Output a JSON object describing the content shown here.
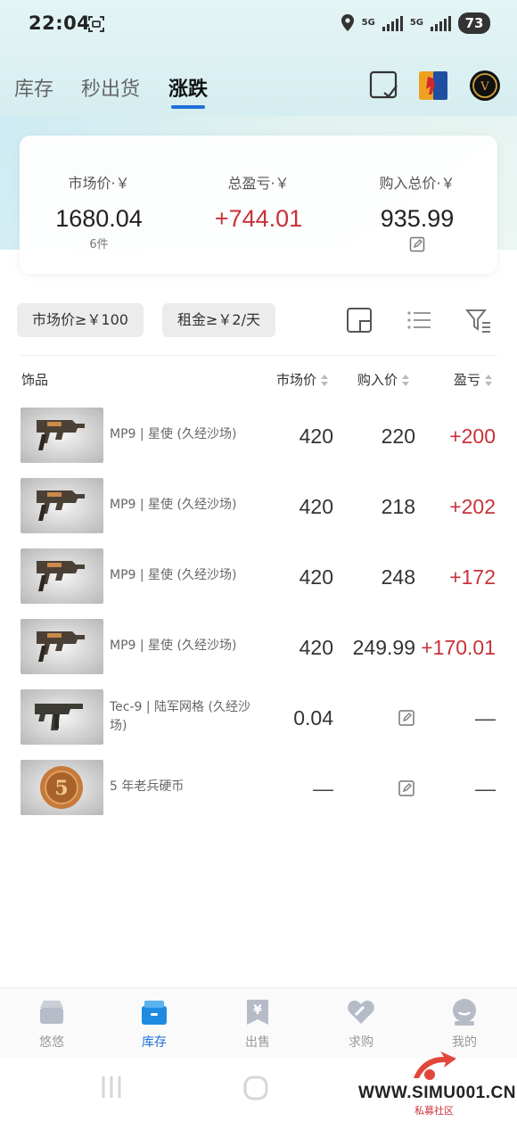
{
  "status": {
    "time": "22:04",
    "network": "5G",
    "battery": "73"
  },
  "tabs": [
    {
      "label": "库存",
      "active": false
    },
    {
      "label": "秒出货",
      "active": false
    },
    {
      "label": "涨跌",
      "active": true
    }
  ],
  "summary": {
    "market_label": "市场价·￥",
    "market_value": "1680.04",
    "market_count": "6件",
    "profit_label": "总盈亏·￥",
    "profit_value": "+744.01",
    "cost_label": "购入总价·￥",
    "cost_value": "935.99"
  },
  "filters": {
    "chip1": "市场价≥￥100",
    "chip2": "租金≥￥2/天"
  },
  "table": {
    "headers": {
      "item": "饰品",
      "market": "市场价",
      "buy": "购入价",
      "pl": "盈亏"
    },
    "rows": [
      {
        "name": "MP9 | 星使 (久经沙场)",
        "market": "420",
        "buy": "220",
        "pl": "+200",
        "thumb": "mp9"
      },
      {
        "name": "MP9 | 星使 (久经沙场)",
        "market": "420",
        "buy": "218",
        "pl": "+202",
        "thumb": "mp9"
      },
      {
        "name": "MP9 | 星使 (久经沙场)",
        "market": "420",
        "buy": "248",
        "pl": "+172",
        "thumb": "mp9"
      },
      {
        "name": "MP9 | 星使 (久经沙场)",
        "market": "420",
        "buy": "249.99",
        "pl": "+170.01",
        "thumb": "mp9"
      },
      {
        "name": "Tec-9 | 陆军网格 (久经沙场)",
        "market": "0.04",
        "buy": "",
        "pl": "—",
        "thumb": "tec9"
      },
      {
        "name": "5 年老兵硬币",
        "market": "—",
        "buy": "",
        "pl": "—",
        "thumb": "coin"
      }
    ]
  },
  "nav": [
    {
      "label": "悠悠",
      "icon": "box-icon",
      "active": false
    },
    {
      "label": "库存",
      "icon": "inventory-icon",
      "active": true
    },
    {
      "label": "出售",
      "icon": "sell-icon",
      "active": false
    },
    {
      "label": "求购",
      "icon": "heart-icon",
      "active": false
    },
    {
      "label": "我的",
      "icon": "profile-icon",
      "active": false
    }
  ],
  "watermark": {
    "text": "WWW.SIMU001.CN",
    "sub": "私募社区"
  },
  "colors": {
    "accent": "#1e6fd9",
    "profit": "#c8323a"
  }
}
